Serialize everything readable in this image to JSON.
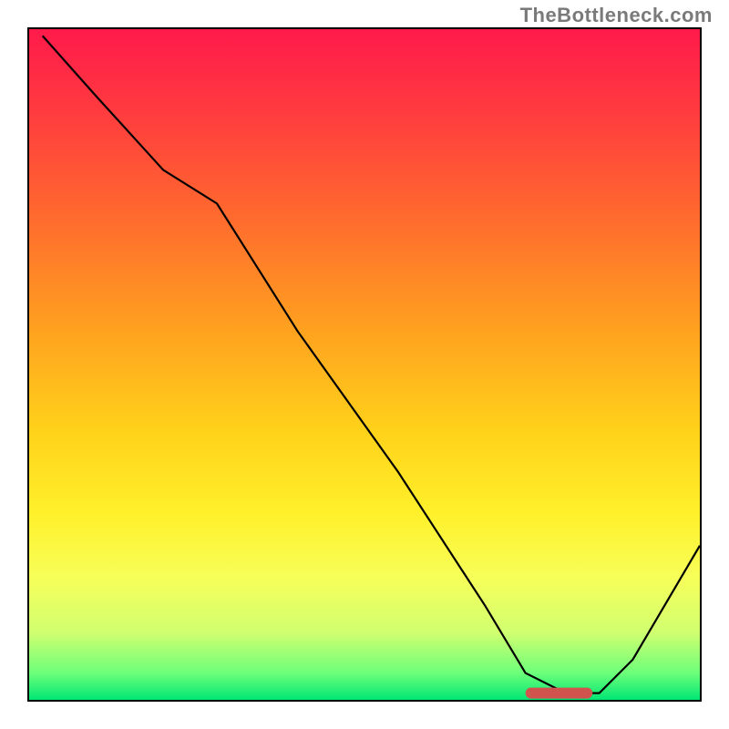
{
  "watermark": "TheBottleneck.com",
  "chart_data": {
    "type": "line",
    "title": "",
    "xlabel": "",
    "ylabel": "",
    "xlim": [
      0,
      100
    ],
    "ylim": [
      0,
      100
    ],
    "series": [
      {
        "name": "curve",
        "x": [
          2,
          10,
          20,
          28,
          40,
          55,
          68,
          74,
          80,
          85,
          90,
          100
        ],
        "values": [
          99,
          90,
          79,
          74,
          55,
          34,
          14,
          4,
          1,
          1,
          6,
          23
        ]
      }
    ],
    "marker": {
      "x_start": 74,
      "x_end": 84,
      "y": 1
    },
    "gradient_stops": [
      {
        "pct": 0,
        "color": "#ff1a4b"
      },
      {
        "pct": 12,
        "color": "#ff3a3f"
      },
      {
        "pct": 28,
        "color": "#ff6a2e"
      },
      {
        "pct": 45,
        "color": "#ffa21f"
      },
      {
        "pct": 60,
        "color": "#ffd21a"
      },
      {
        "pct": 72,
        "color": "#fff02a"
      },
      {
        "pct": 82,
        "color": "#f6ff5a"
      },
      {
        "pct": 90,
        "color": "#d0ff70"
      },
      {
        "pct": 96,
        "color": "#6dff7a"
      },
      {
        "pct": 100,
        "color": "#00e673"
      }
    ]
  }
}
